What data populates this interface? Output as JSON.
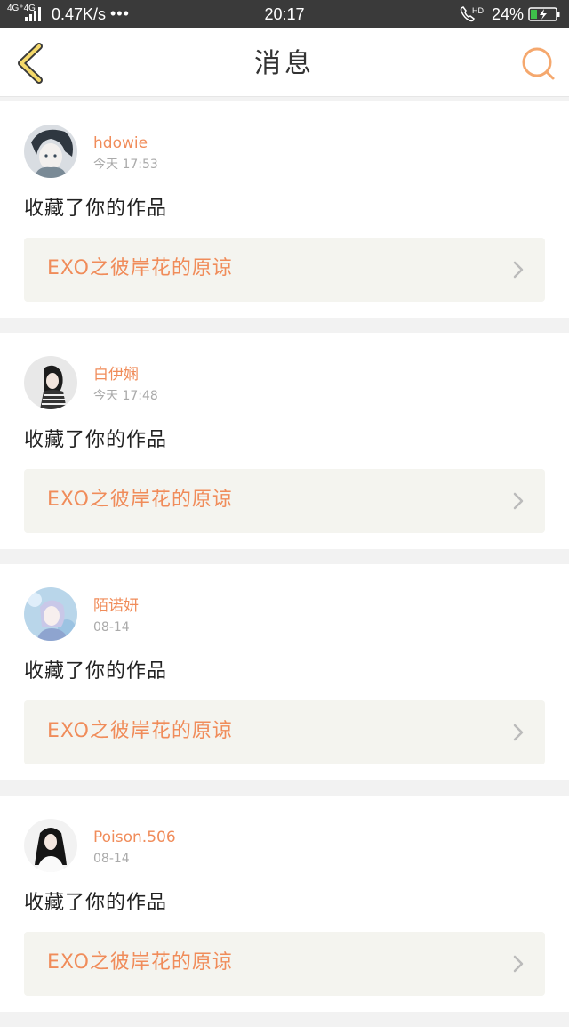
{
  "status_bar": {
    "network": "4G⁺4G",
    "speed": "0.47K/s",
    "dots": "•••",
    "time": "20:17",
    "hd": "HD",
    "battery_pct": "24%"
  },
  "header": {
    "title": "消息",
    "accent_color": "#f5a86e"
  },
  "messages": [
    {
      "username": "hdowie",
      "time": "今天 17:53",
      "action": "收藏了你的作品",
      "work_title": "EXO之彼岸花的原谅",
      "avatar": "anime-avatar"
    },
    {
      "username": "白伊娴",
      "time": "今天 17:48",
      "action": "收藏了你的作品",
      "work_title": "EXO之彼岸花的原谅",
      "avatar": "girl-photo-avatar"
    },
    {
      "username": "陌诺妍",
      "time": "08-14",
      "action": "收藏了你的作品",
      "work_title": "EXO之彼岸花的原谅",
      "avatar": "anime-avatar"
    },
    {
      "username": "Poison.506",
      "time": "08-14",
      "action": "收藏了你的作品",
      "work_title": "EXO之彼岸花的原谅",
      "avatar": "girl-photo-avatar"
    }
  ]
}
